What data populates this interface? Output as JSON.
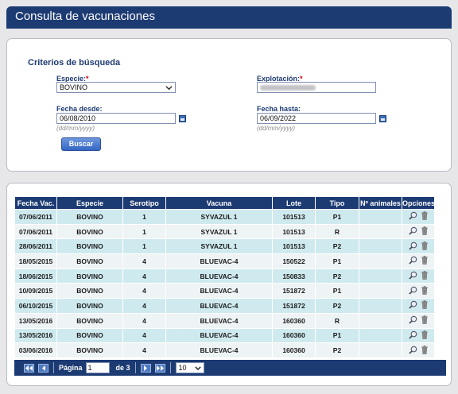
{
  "page": {
    "title": "Consulta de vacunaciones"
  },
  "search": {
    "section_title": "Criterios de búsqueda",
    "especie_label": "Especie:",
    "especie_value": "BOVINO",
    "explotacion_label": "Explotación:",
    "explotacion_value": "",
    "fecha_desde_label": "Fecha desde:",
    "fecha_desde_value": "06/08/2010",
    "fecha_hasta_label": "Fecha hasta:",
    "fecha_hasta_value": "06/09/2022",
    "date_hint": "(dd/mm/yyyy)",
    "required_mark": "*",
    "buscar_label": "Buscar"
  },
  "table": {
    "headers": [
      "Fecha Vac.",
      "Especie",
      "Serotipo",
      "Vacuna",
      "Lote",
      "Tipo",
      "Nº animales",
      "Opciones"
    ],
    "rows": [
      [
        "07/06/2011",
        "BOVINO",
        "1",
        "SYVAZUL 1",
        "101513",
        "P1",
        ""
      ],
      [
        "07/06/2011",
        "BOVINO",
        "1",
        "SYVAZUL 1",
        "101513",
        "R",
        ""
      ],
      [
        "28/06/2011",
        "BOVINO",
        "1",
        "SYVAZUL 1",
        "101513",
        "P2",
        ""
      ],
      [
        "18/05/2015",
        "BOVINO",
        "4",
        "BLUEVAC-4",
        "150522",
        "P1",
        ""
      ],
      [
        "18/06/2015",
        "BOVINO",
        "4",
        "BLUEVAC-4",
        "150833",
        "P2",
        ""
      ],
      [
        "10/09/2015",
        "BOVINO",
        "4",
        "BLUEVAC-4",
        "151872",
        "P1",
        ""
      ],
      [
        "06/10/2015",
        "BOVINO",
        "4",
        "BLUEVAC-4",
        "151872",
        "P2",
        ""
      ],
      [
        "13/05/2016",
        "BOVINO",
        "4",
        "BLUEVAC-4",
        "160360",
        "R",
        ""
      ],
      [
        "13/05/2016",
        "BOVINO",
        "4",
        "BLUEVAC-4",
        "160360",
        "P1",
        ""
      ],
      [
        "03/06/2016",
        "BOVINO",
        "4",
        "BLUEVAC-4",
        "160360",
        "P2",
        ""
      ]
    ]
  },
  "pager": {
    "page_label": "Página",
    "page_value": "1",
    "of_label": "de 3",
    "page_size": "10"
  },
  "colors": {
    "primary": "#1d3b73",
    "row_odd": "#cfeaef",
    "row_even": "#eef3f5",
    "required": "#cc0000"
  }
}
